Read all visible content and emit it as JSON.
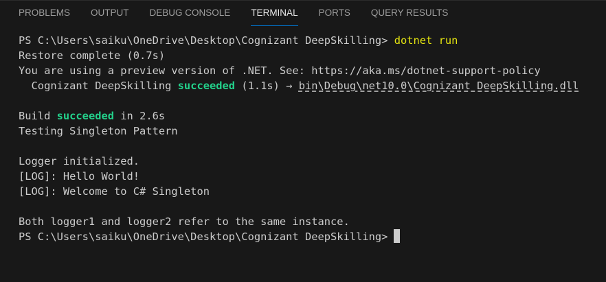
{
  "tabs": [
    {
      "label": "PROBLEMS"
    },
    {
      "label": "OUTPUT"
    },
    {
      "label": "DEBUG CONSOLE"
    },
    {
      "label": "TERMINAL",
      "active": true
    },
    {
      "label": "PORTS"
    },
    {
      "label": "QUERY RESULTS"
    }
  ],
  "terminal": {
    "prompt": "PS C:\\Users\\saiku\\OneDrive\\Desktop\\Cognizant DeepSkilling>",
    "command": "dotnet run",
    "restore": "Restore complete (0.7s)",
    "preview": "You are using a preview version of .NET. See: https://aka.ms/dotnet-support-policy",
    "project_prefix": "  Cognizant DeepSkilling ",
    "project_status": "succeeded",
    "project_time": " (1.1s) → ",
    "project_output": "bin\\Debug\\net10.0\\Cognizant DeepSkilling.dll",
    "build_prefix": "Build ",
    "build_status": "succeeded",
    "build_suffix": " in 2.6s",
    "testing": "Testing Singleton Pattern",
    "logger_init": "Logger initialized.",
    "log1": "[LOG]: Hello World!",
    "log2": "[LOG]: Welcome to C# Singleton",
    "same_instance": "Both logger1 and logger2 refer to the same instance.",
    "final_prompt": "PS C:\\Users\\saiku\\OneDrive\\Desktop\\Cognizant DeepSkilling>"
  },
  "colors": {
    "background": "#181818",
    "text": "#cccccc",
    "command": "#e5e510",
    "success": "#23d18b",
    "active_tab_underline": "#0078d4"
  }
}
